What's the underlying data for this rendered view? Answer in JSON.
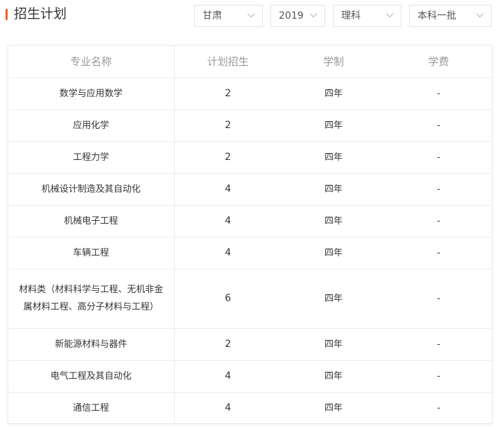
{
  "header": {
    "title": "招生计划"
  },
  "filters": {
    "province": "甘肃",
    "year": "2019",
    "subject": "理科",
    "batch": "本科一批"
  },
  "table": {
    "columns": [
      "专业名称",
      "计划招生",
      "学制",
      "学费"
    ],
    "rows": [
      {
        "major": "数学与应用数学",
        "plan": "2",
        "duration": "四年",
        "fee": "-"
      },
      {
        "major": "应用化学",
        "plan": "2",
        "duration": "四年",
        "fee": "-"
      },
      {
        "major": "工程力学",
        "plan": "2",
        "duration": "四年",
        "fee": "-"
      },
      {
        "major": "机械设计制造及其自动化",
        "plan": "4",
        "duration": "四年",
        "fee": "-"
      },
      {
        "major": "机械电子工程",
        "plan": "4",
        "duration": "四年",
        "fee": "-"
      },
      {
        "major": "车辆工程",
        "plan": "4",
        "duration": "四年",
        "fee": "-"
      },
      {
        "major": "材料类（材料科学与工程、无机非金属材料工程、高分子材料与工程）",
        "plan": "6",
        "duration": "四年",
        "fee": "-"
      },
      {
        "major": "新能源材料与器件",
        "plan": "2",
        "duration": "四年",
        "fee": "-"
      },
      {
        "major": "电气工程及其自动化",
        "plan": "4",
        "duration": "四年",
        "fee": "-"
      },
      {
        "major": "通信工程",
        "plan": "4",
        "duration": "四年",
        "fee": "-"
      }
    ]
  },
  "icons": {
    "dropdown": "chevron-down-icon"
  },
  "colors": {
    "accent": "#f0641e",
    "header_text": "#999999",
    "border": "#ececec"
  }
}
